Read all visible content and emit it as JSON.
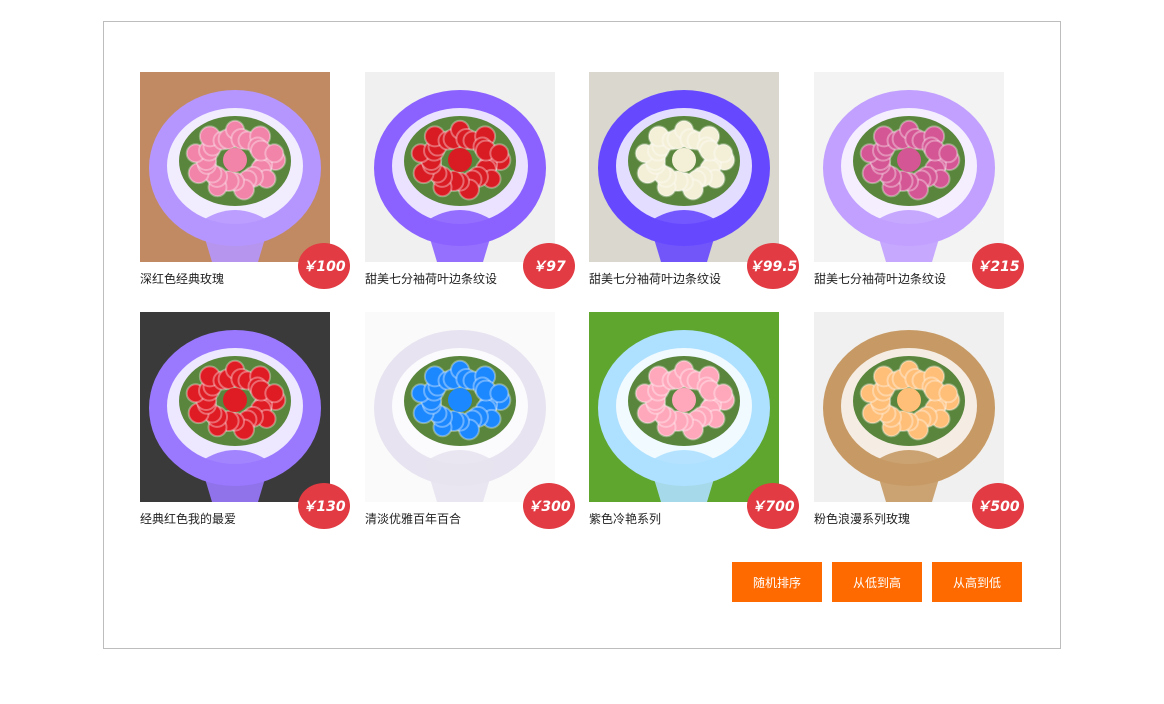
{
  "products": [
    {
      "name": "深红色经典玫瑰",
      "price": "￥100",
      "icon": "pink-carnation-bouquet-icon",
      "colors": {
        "wrap": "#b596ff",
        "flower": "#f283a9",
        "bg": "#c18a62"
      }
    },
    {
      "name": "甜美七分袖荷叶边条纹设",
      "price": "￥97",
      "icon": "red-rose-bouquet-icon",
      "colors": {
        "wrap": "#8b62ff",
        "flower": "#d91b23",
        "bg": "#f0f0f0"
      }
    },
    {
      "name": "甜美七分袖荷叶边条纹设",
      "price": "￥99.5",
      "icon": "white-lily-bouquet-icon",
      "colors": {
        "wrap": "#6648ff",
        "flower": "#f4f0d8",
        "bg": "#d9d7ce"
      }
    },
    {
      "name": "甜美七分袖荷叶边条纹设",
      "price": "￥215",
      "icon": "pink-rose-bouquet-icon",
      "colors": {
        "wrap": "#c1a0ff",
        "flower": "#d55694",
        "bg": "#f3f3f3"
      }
    },
    {
      "name": "经典红色我的最爱",
      "price": "￥130",
      "icon": "red-rose-teddy-bouquet-icon",
      "colors": {
        "wrap": "#9a79ff",
        "flower": "#df1b24",
        "bg": "#3a3a3a"
      }
    },
    {
      "name": "清淡优雅百年百合",
      "price": "￥300",
      "icon": "blue-rose-teddy-bouquet-icon",
      "colors": {
        "wrap": "#e7e3f0",
        "flower": "#1c88ff",
        "bg": "#fafafa"
      }
    },
    {
      "name": "紫色冷艳系列",
      "price": "￥700",
      "icon": "peach-rose-bouquet-icon",
      "colors": {
        "wrap": "#aee0ff",
        "flower": "#ffa7bb",
        "bg": "#5ea62d"
      }
    },
    {
      "name": "粉色浪漫系列玫瑰",
      "price": "￥500",
      "icon": "champagne-rose-teddy-bouquet-icon",
      "colors": {
        "wrap": "#c79a65",
        "flower": "#ffbf78",
        "bg": "#f0f0f0"
      }
    }
  ],
  "buttons": {
    "random": "随机排序",
    "asc": "从低到高",
    "desc": "从高到低"
  }
}
